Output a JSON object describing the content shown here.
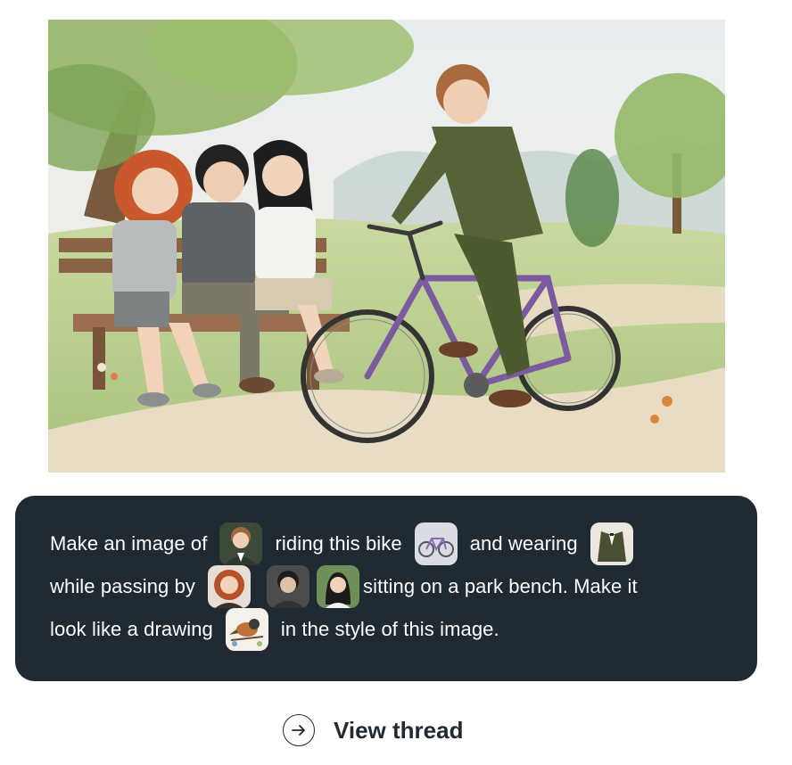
{
  "hero_image": {
    "alt_name": "watercolor illustration of a boy in a green suit riding a purple bike past three friends on a park bench"
  },
  "prompt": {
    "line1": {
      "text_a": "Make an image of",
      "text_b": "riding this bike",
      "text_c": "and wearing"
    },
    "line2": {
      "text_a": "while passing by",
      "text_b": "sitting on a park bench. Make it"
    },
    "line3": {
      "text_a": "look like a drawing",
      "text_b": "in the style of this image."
    },
    "thumbnails": [
      "person-boy-avatar",
      "bike-thumbnail",
      "suit-thumbnail",
      "redhead-girl-avatar",
      "dark-hair-boy-avatar",
      "smiling-girl-avatar",
      "bird-drawing-thumbnail"
    ]
  },
  "footer": {
    "view_thread_label": "View thread",
    "icon": "arrow-right-icon"
  },
  "colors": {
    "card_bg": "#1f2a33",
    "card_text": "#ffffff",
    "page_bg": "#ffffff",
    "link_text": "#1f2a33"
  }
}
